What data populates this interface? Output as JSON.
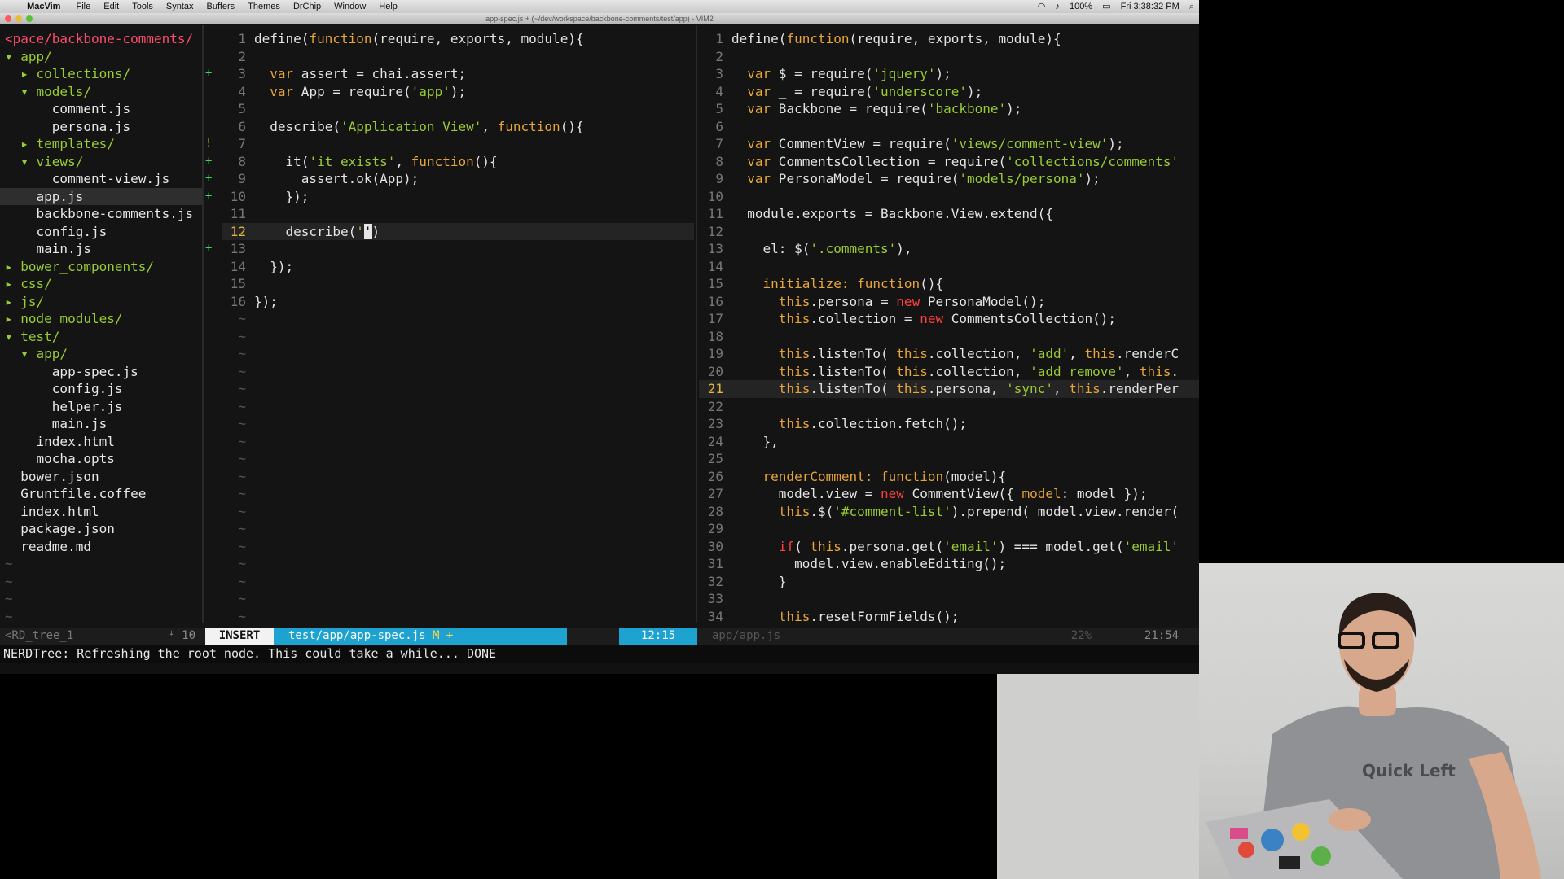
{
  "menubar": {
    "app": "MacVim",
    "items": [
      "File",
      "Edit",
      "Tools",
      "Syntax",
      "Buffers",
      "Themes",
      "DrChip",
      "Window",
      "Help"
    ],
    "battery": "100%",
    "clock": "Fri 3:38:32 PM"
  },
  "window": {
    "title": "app-spec.js + (~/dev/workspace/backbone-comments/test/app) - VIM2"
  },
  "tree": [
    {
      "text": "<pace/backbone-comments/",
      "kind": "root"
    },
    {
      "text": "▾ app/",
      "kind": "dir"
    },
    {
      "text": "  ▸ collections/",
      "kind": "dir"
    },
    {
      "text": "  ▾ models/",
      "kind": "dir"
    },
    {
      "text": "      comment.js",
      "kind": "file"
    },
    {
      "text": "      persona.js",
      "kind": "file"
    },
    {
      "text": "  ▸ templates/",
      "kind": "dir"
    },
    {
      "text": "  ▾ views/",
      "kind": "dir"
    },
    {
      "text": "      comment-view.js",
      "kind": "file"
    },
    {
      "text": "    app.js",
      "kind": "sel"
    },
    {
      "text": "    backbone-comments.js",
      "kind": "file"
    },
    {
      "text": "    config.js",
      "kind": "file"
    },
    {
      "text": "    main.js",
      "kind": "file"
    },
    {
      "text": "▸ bower_components/",
      "kind": "dir"
    },
    {
      "text": "▸ css/",
      "kind": "dir"
    },
    {
      "text": "▸ js/",
      "kind": "dir"
    },
    {
      "text": "▸ node_modules/",
      "kind": "dir"
    },
    {
      "text": "▾ test/",
      "kind": "dir"
    },
    {
      "text": "  ▾ app/",
      "kind": "dir"
    },
    {
      "text": "      app-spec.js",
      "kind": "file"
    },
    {
      "text": "      config.js",
      "kind": "file"
    },
    {
      "text": "      helper.js",
      "kind": "file"
    },
    {
      "text": "      main.js",
      "kind": "file"
    },
    {
      "text": "    index.html",
      "kind": "file"
    },
    {
      "text": "    mocha.opts",
      "kind": "file"
    },
    {
      "text": "  bower.json",
      "kind": "file"
    },
    {
      "text": "  Gruntfile.coffee",
      "kind": "file"
    },
    {
      "text": "  index.html",
      "kind": "file"
    },
    {
      "text": "  package.json",
      "kind": "file"
    },
    {
      "text": "  readme.md",
      "kind": "file"
    },
    {
      "text": "~",
      "kind": "tilde"
    },
    {
      "text": "~",
      "kind": "tilde"
    },
    {
      "text": "~",
      "kind": "tilde"
    },
    {
      "text": "~",
      "kind": "tilde"
    }
  ],
  "gutter_signs": [
    "",
    "",
    "+",
    "",
    "",
    "",
    "!",
    "+",
    "+",
    "+",
    "",
    "",
    "+"
  ],
  "left_code": {
    "lines": [
      [
        [
          "",
          "define("
        ],
        [
          "kw",
          "function"
        ],
        [
          "",
          "(require, exports, module){"
        ]
      ],
      [],
      [
        [
          "",
          "  "
        ],
        [
          "kw",
          "var"
        ],
        [
          "",
          " assert = chai.assert;"
        ]
      ],
      [
        [
          "",
          "  "
        ],
        [
          "kw",
          "var"
        ],
        [
          "",
          " App = require("
        ],
        [
          "str",
          "'app'"
        ],
        [
          "",
          ");"
        ]
      ],
      [],
      [
        [
          "",
          "  describe("
        ],
        [
          "str",
          "'Application View'"
        ],
        [
          "",
          ", "
        ],
        [
          "kw",
          "function"
        ],
        [
          "",
          "(){"
        ]
      ],
      [],
      [
        [
          "",
          "    it("
        ],
        [
          "str",
          "'it exists'"
        ],
        [
          "",
          ", "
        ],
        [
          "kw",
          "function"
        ],
        [
          "",
          "(){"
        ]
      ],
      [
        [
          "",
          "      assert.ok(App);"
        ]
      ],
      [
        [
          "",
          "    });"
        ]
      ],
      [],
      [
        [
          "",
          "    describe("
        ],
        [
          "str",
          "'"
        ],
        [
          "cursor",
          "'"
        ],
        [
          "",
          ")"
        ]
      ],
      [],
      [
        [
          "",
          "  });"
        ]
      ],
      [],
      [
        [
          "",
          "});"
        ]
      ]
    ],
    "current": 12,
    "tildes": 18
  },
  "right_code": {
    "lines": [
      [
        [
          "",
          "define("
        ],
        [
          "kw",
          "function"
        ],
        [
          "",
          "(require, exports, module){"
        ]
      ],
      [],
      [
        [
          "",
          "  "
        ],
        [
          "kw",
          "var"
        ],
        [
          "",
          " $ = require("
        ],
        [
          "str",
          "'jquery'"
        ],
        [
          "",
          ");"
        ]
      ],
      [
        [
          "",
          "  "
        ],
        [
          "kw",
          "var"
        ],
        [
          "",
          " _ = require("
        ],
        [
          "str",
          "'underscore'"
        ],
        [
          "",
          ");"
        ]
      ],
      [
        [
          "",
          "  "
        ],
        [
          "kw",
          "var"
        ],
        [
          "",
          " Backbone = require("
        ],
        [
          "str",
          "'backbone'"
        ],
        [
          "",
          ");"
        ]
      ],
      [],
      [
        [
          "",
          "  "
        ],
        [
          "kw",
          "var"
        ],
        [
          "",
          " CommentView = require("
        ],
        [
          "str",
          "'views/comment-view'"
        ],
        [
          "",
          ");"
        ]
      ],
      [
        [
          "",
          "  "
        ],
        [
          "kw",
          "var"
        ],
        [
          "",
          " CommentsCollection = require("
        ],
        [
          "str",
          "'collections/comments'"
        ]
      ],
      [
        [
          "",
          "  "
        ],
        [
          "kw",
          "var"
        ],
        [
          "",
          " PersonaModel = require("
        ],
        [
          "str",
          "'models/persona'"
        ],
        [
          "",
          ");"
        ]
      ],
      [],
      [
        [
          "",
          "  module.exports = Backbone.View.extend({"
        ]
      ],
      [],
      [
        [
          "",
          "    el: $("
        ],
        [
          "str",
          "'.comments'"
        ],
        [
          "",
          "),"
        ]
      ],
      [],
      [
        [
          "",
          "    "
        ],
        [
          "kw",
          "initialize: function"
        ],
        [
          "",
          "(){"
        ]
      ],
      [
        [
          "",
          "      "
        ],
        [
          "kw",
          "this"
        ],
        [
          "",
          ".persona = "
        ],
        [
          "new",
          "new"
        ],
        [
          "",
          " PersonaModel();"
        ]
      ],
      [
        [
          "",
          "      "
        ],
        [
          "kw",
          "this"
        ],
        [
          "",
          ".collection = "
        ],
        [
          "new",
          "new"
        ],
        [
          "",
          " CommentsCollection();"
        ]
      ],
      [],
      [
        [
          "",
          "      "
        ],
        [
          "kw",
          "this"
        ],
        [
          "",
          ".listenTo( "
        ],
        [
          "kw",
          "this"
        ],
        [
          "",
          ".collection, "
        ],
        [
          "str",
          "'add'"
        ],
        [
          "",
          ", "
        ],
        [
          "kw",
          "this"
        ],
        [
          "",
          ".renderC"
        ]
      ],
      [
        [
          "",
          "      "
        ],
        [
          "kw",
          "this"
        ],
        [
          "",
          ".listenTo( "
        ],
        [
          "kw",
          "this"
        ],
        [
          "",
          ".collection, "
        ],
        [
          "str",
          "'add remove'"
        ],
        [
          "",
          ", "
        ],
        [
          "kw",
          "this"
        ],
        [
          "",
          "."
        ]
      ],
      [
        [
          "",
          "      "
        ],
        [
          "kw",
          "this"
        ],
        [
          "",
          ".listenTo( "
        ],
        [
          "kw",
          "this"
        ],
        [
          "",
          ".persona, "
        ],
        [
          "str",
          "'sync'"
        ],
        [
          "",
          ", "
        ],
        [
          "kw",
          "this"
        ],
        [
          "",
          ".renderPer"
        ]
      ],
      [],
      [
        [
          "",
          "      "
        ],
        [
          "kw",
          "this"
        ],
        [
          "",
          ".collection.fetch();"
        ]
      ],
      [
        [
          "",
          "    },"
        ]
      ],
      [],
      [
        [
          "",
          "    "
        ],
        [
          "kw",
          "renderComment: function"
        ],
        [
          "",
          "(model){"
        ]
      ],
      [
        [
          "",
          "      model.view = "
        ],
        [
          "new",
          "new"
        ],
        [
          "",
          " CommentView({ "
        ],
        [
          "kw",
          "model"
        ],
        [
          "",
          ": model });"
        ]
      ],
      [
        [
          "",
          "      "
        ],
        [
          "kw",
          "this"
        ],
        [
          "",
          ".$("
        ],
        [
          "str",
          "'#comment-list'"
        ],
        [
          "",
          ").prepend( model.view.render("
        ]
      ],
      [],
      [
        [
          "",
          "      "
        ],
        [
          "new",
          "if"
        ],
        [
          "",
          "( "
        ],
        [
          "kw",
          "this"
        ],
        [
          "",
          ".persona.get("
        ],
        [
          "str",
          "'email'"
        ],
        [
          "",
          ") === model.get("
        ],
        [
          "str",
          "'email'"
        ]
      ],
      [
        [
          "",
          "        model.view.enableEditing();"
        ]
      ],
      [
        [
          "",
          "      }"
        ]
      ],
      [],
      [
        [
          "",
          "      "
        ],
        [
          "kw",
          "this"
        ],
        [
          "",
          ".resetFormFields();"
        ]
      ]
    ],
    "current": 21
  },
  "statusline": {
    "tree_name": "<RD_tree_1",
    "tree_pos": "10",
    "mode": "INSERT",
    "file": "test/app/app-spec.js",
    "modified": "M +",
    "pos": "12:15",
    "file2": "app/app.js",
    "pct2": "22%",
    "pos2": "21:54"
  },
  "cmdline": "NERDTree: Refreshing the root node. This could take a while... DONE",
  "webcam": {
    "shirt_text": "Quick Left",
    "shirt_color": "#8f9194",
    "skin_color": "#d8a88c",
    "hair_color": "#2a1e18",
    "laptop_color": "#b9b9bb"
  }
}
